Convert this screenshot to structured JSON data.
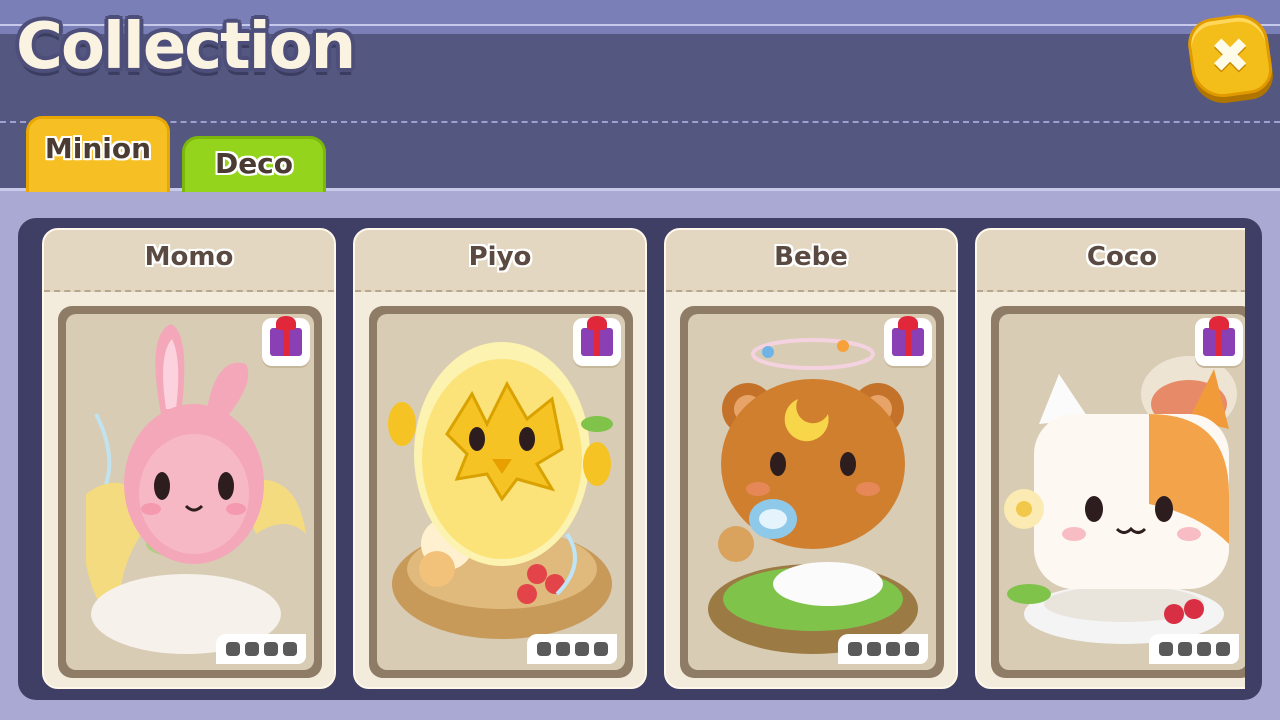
{
  "window": {
    "title": "Collection",
    "close_glyph": "✖"
  },
  "tabs": [
    {
      "label": "Minion",
      "active": true,
      "color": "#f6c024"
    },
    {
      "label": "Deco",
      "active": false,
      "color": "#95d41c"
    }
  ],
  "cards": [
    {
      "name": "Momo",
      "creature": "pink-bunny",
      "reward_icon": "gift-icon",
      "progress_slots": 4
    },
    {
      "name": "Piyo",
      "creature": "yellow-chick-in-egg",
      "reward_icon": "gift-icon",
      "progress_slots": 4
    },
    {
      "name": "Bebe",
      "creature": "brown-bear-with-pacifier",
      "reward_icon": "gift-icon",
      "progress_slots": 4
    },
    {
      "name": "Coco",
      "creature": "calico-cat-teacup",
      "reward_icon": "gift-icon",
      "progress_slots": 4
    }
  ],
  "colors": {
    "header": "#54577f",
    "panel": "#3f3f66",
    "close_button": "#f4be1a"
  }
}
